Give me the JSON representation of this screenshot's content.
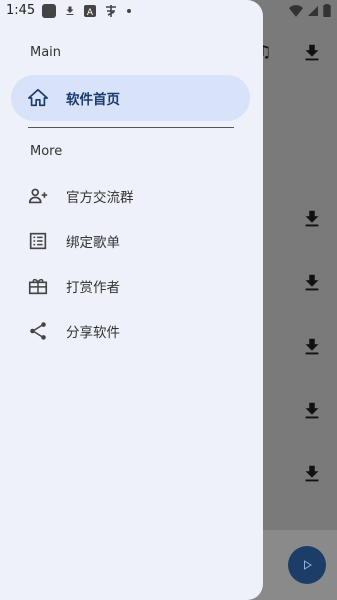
{
  "status_bar": {
    "time": "1:45"
  },
  "drawer": {
    "section_main": "Main",
    "section_more": "More",
    "items": [
      {
        "label": "软件首页",
        "icon": "home-icon",
        "active": true
      },
      {
        "label": "官方交流群",
        "icon": "group-add-icon"
      },
      {
        "label": "绑定歌单",
        "icon": "list-icon"
      },
      {
        "label": "打赏作者",
        "icon": "gift-icon"
      },
      {
        "label": "分享软件",
        "icon": "share-icon"
      }
    ]
  },
  "colors": {
    "accent": "#1a3b6e",
    "active_bg": "#d8e2f8",
    "drawer_bg": "#eff1fa",
    "play": "#1b3d68"
  }
}
